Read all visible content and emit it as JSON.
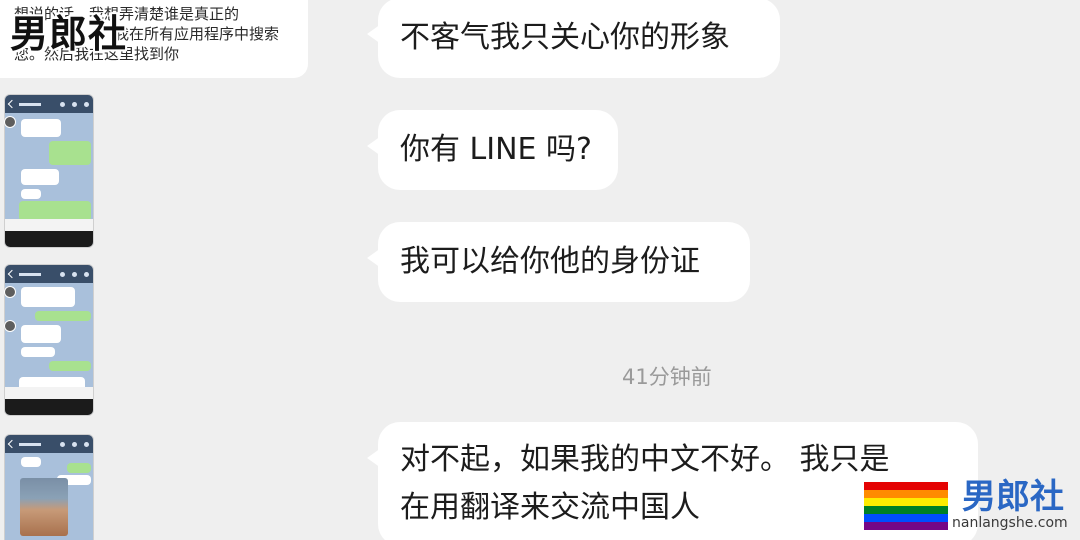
{
  "left_panel": {
    "top_bubble_lines": [
      "想说的话。我想弄清楚谁是真正的",
      "我在所有应用程序中搜索",
      "您。然后我在这里找到你"
    ]
  },
  "watermark": {
    "logo_text": "男郎社",
    "url": "nanlangshe.com",
    "flag_colors": [
      "#e40303",
      "#ff8c00",
      "#ffed00",
      "#008026",
      "#004dff",
      "#750787"
    ]
  },
  "chat": {
    "messages": [
      {
        "lines": [
          "不客气我只关心你的形象"
        ]
      },
      {
        "lines": [
          "你有 LINE 吗?"
        ]
      },
      {
        "lines": [
          "我可以给你他的身份证"
        ]
      },
      {
        "lines": [
          "对不起，如果我的中文不好。 我只是",
          "在用翻译来交流中国人"
        ]
      }
    ],
    "timestamp": "41分钟前"
  },
  "colors": {
    "background": "#efefef",
    "bubble": "#ffffff",
    "timestamp": "#9a9a9a",
    "line_header": "#394e69",
    "line_green": "#a8e18f",
    "line_bg": "#a9c0db"
  }
}
